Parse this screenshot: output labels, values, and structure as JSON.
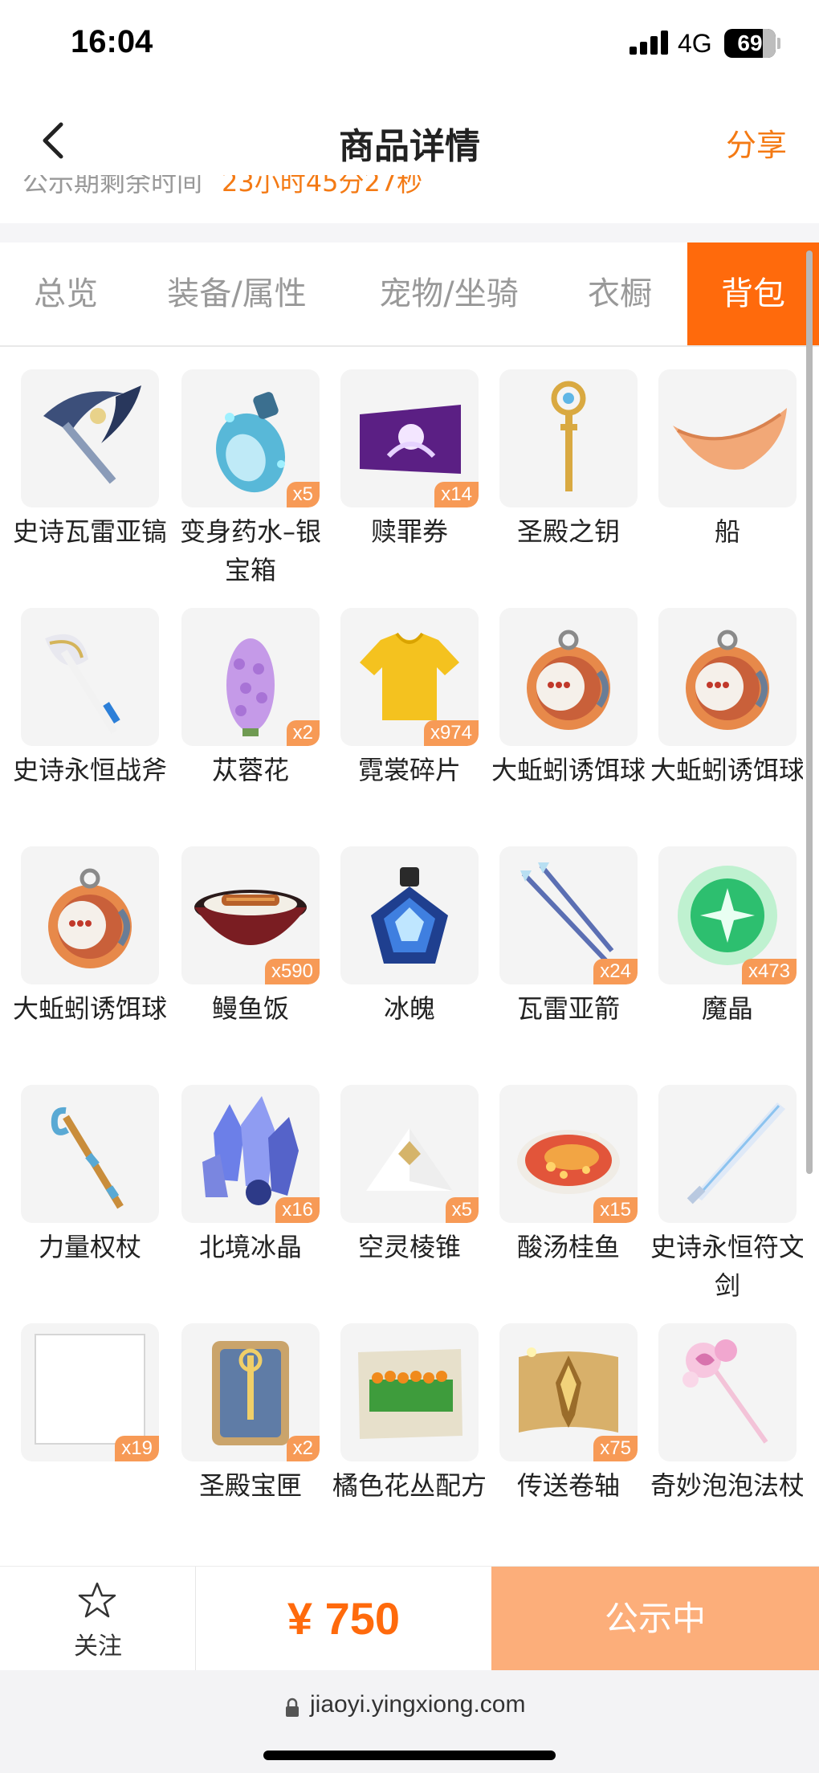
{
  "status": {
    "time": "16:04",
    "network": "4G",
    "battery": "69"
  },
  "nav": {
    "title": "商品详情",
    "share": "分享"
  },
  "peek": {
    "label": "公示期剩余时间",
    "value": "23小时45分27秒"
  },
  "tabs": [
    {
      "label": "总览",
      "active": false
    },
    {
      "label": "装备/属性",
      "active": false
    },
    {
      "label": "宠物/坐骑",
      "active": false
    },
    {
      "label": "衣橱",
      "active": false
    },
    {
      "label": "背包",
      "active": true
    }
  ],
  "items": [
    {
      "name": "史诗瓦雷亚镐",
      "count": "",
      "icon": "pickaxe"
    },
    {
      "name": "变身药水–银宝箱",
      "count": "x5",
      "icon": "potion-bottle"
    },
    {
      "name": "赎罪券",
      "count": "x14",
      "icon": "purple-ticket"
    },
    {
      "name": "圣殿之钥",
      "count": "",
      "icon": "golden-key"
    },
    {
      "name": "船",
      "count": "",
      "icon": "boat"
    },
    {
      "name": "史诗永恒战斧",
      "count": "",
      "icon": "battle-axe"
    },
    {
      "name": "苁蓉花",
      "count": "x2",
      "icon": "purple-flower"
    },
    {
      "name": "霓裳碎片",
      "count": "x974",
      "icon": "yellow-shirt"
    },
    {
      "name": "大蚯蚓诱饵球",
      "count": "",
      "icon": "bait-ball"
    },
    {
      "name": "大蚯蚓诱饵球",
      "count": "",
      "icon": "bait-ball"
    },
    {
      "name": "大蚯蚓诱饵球",
      "count": "",
      "icon": "bait-ball"
    },
    {
      "name": "鳗鱼饭",
      "count": "x590",
      "icon": "eel-rice-bowl"
    },
    {
      "name": "冰魄",
      "count": "",
      "icon": "ice-gem-flask"
    },
    {
      "name": "瓦雷亚箭",
      "count": "x24",
      "icon": "arrows"
    },
    {
      "name": "魔晶",
      "count": "x473",
      "icon": "green-crystal"
    },
    {
      "name": "力量权杖",
      "count": "",
      "icon": "scepter"
    },
    {
      "name": "北境冰晶",
      "count": "x16",
      "icon": "ice-crystals"
    },
    {
      "name": "空灵棱锥",
      "count": "x5",
      "icon": "white-pyramid"
    },
    {
      "name": "酸汤桂鱼",
      "count": "x15",
      "icon": "fish-soup"
    },
    {
      "name": "史诗永恒符文剑",
      "count": "",
      "icon": "rune-sword"
    },
    {
      "name": "",
      "count": "x19",
      "icon": "empty-slot"
    },
    {
      "name": "圣殿宝匣",
      "count": "x2",
      "icon": "temple-box"
    },
    {
      "name": "橘色花丛配方",
      "count": "",
      "icon": "flower-recipe"
    },
    {
      "name": "传送卷轴",
      "count": "x75",
      "icon": "teleport-scroll"
    },
    {
      "name": "奇妙泡泡法杖",
      "count": "",
      "icon": "bubble-wand"
    }
  ],
  "bottom": {
    "follow": "关注",
    "price": "¥ 750",
    "cta": "公示中"
  },
  "browser": {
    "url": "jiaoyi.yingxiong.com"
  },
  "colors": {
    "accent": "#ff6a0c",
    "cta_bg": "#fcae7a",
    "badge": "#f79a56"
  }
}
